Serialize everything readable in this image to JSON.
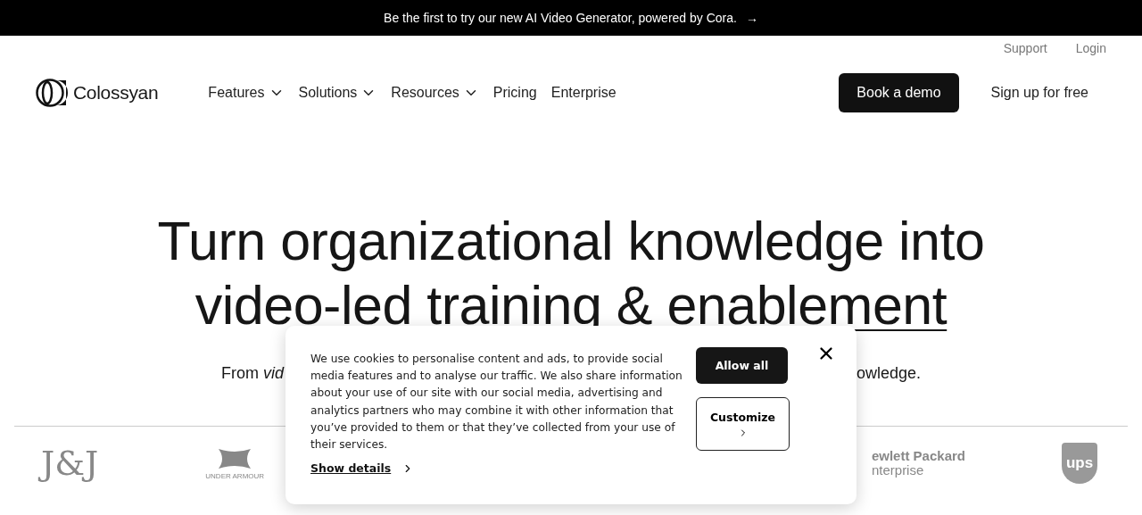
{
  "announcement": {
    "text": "Be the first to try our new AI Video Generator, powered by Cora.",
    "arrow": "→"
  },
  "top_links": [
    "Support",
    "Login"
  ],
  "logo": {
    "name": "Colossyan"
  },
  "nav": [
    {
      "label": "Features",
      "dropdown": true
    },
    {
      "label": "Solutions",
      "dropdown": true
    },
    {
      "label": "Resources",
      "dropdown": true
    },
    {
      "label": "Pricing",
      "dropdown": false
    },
    {
      "label": "Enterprise",
      "dropdown": false
    }
  ],
  "actions": {
    "primary": "Book a demo",
    "secondary": "Sign up for free"
  },
  "hero": {
    "heading_line_1": "Turn organizational knowledge into",
    "heading_line_2_plain": "video-led training & ",
    "heading_line_2_underlined": "enablement",
    "subtitle_left": "From *vid*",
    "subtitle_right": "owledge."
  },
  "customer_logos": [
    {
      "kind": "wordmark",
      "text": "J&J"
    },
    {
      "kind": "emblem",
      "text": "UNDER ARMOUR"
    },
    {
      "kind": "hpe",
      "text": "ewlett Packard",
      "subtext": "nterprise"
    },
    {
      "kind": "shield",
      "text": "ups"
    }
  ],
  "cookie_dialog": {
    "message": "We use cookies to personalise content and ads, to provide social media features and to analyse our traffic. We also share information about your use of our site with our social media, advertising and analytics partners who may combine it with other information that you’ve provided to them or that they’ve collected from your use of their services.",
    "details_link": "Show details",
    "allow_button": "Allow all",
    "customize_button": "Customize"
  }
}
